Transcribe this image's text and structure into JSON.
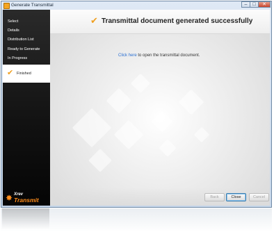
{
  "window": {
    "title": "Generate Transmittal",
    "minimize_glyph": "–",
    "maximize_glyph": "□",
    "close_glyph": "✕"
  },
  "sidebar": {
    "steps": [
      {
        "label": "Select"
      },
      {
        "label": "Details"
      },
      {
        "label": "Distribution List"
      },
      {
        "label": "Ready to Generate"
      },
      {
        "label": "In Progress"
      },
      {
        "label": "Finished",
        "active": true
      }
    ],
    "logo": {
      "line1": "Xrev",
      "line2": "Transmit"
    }
  },
  "main": {
    "title": "Transmittal document generated successfully",
    "link_text": "Click here",
    "link_suffix": " to open the transmittal document."
  },
  "buttons": {
    "back": "Back",
    "close": "Close",
    "cancel": "Cancel"
  },
  "icons": {
    "check": "checkmark-icon"
  },
  "colors": {
    "accent": "#f0a020",
    "link": "#2a6fd1",
    "sidebar_bg": "#111111"
  }
}
